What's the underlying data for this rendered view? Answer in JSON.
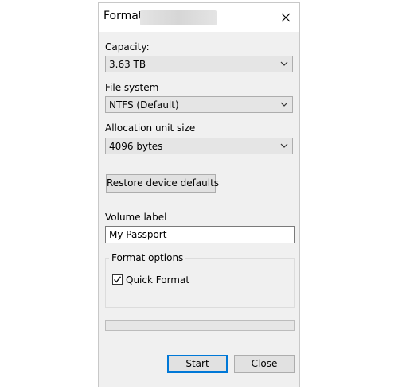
{
  "window": {
    "title": "Format",
    "close_icon": "close-icon"
  },
  "capacity": {
    "label": "Capacity:",
    "value": "3.63 TB"
  },
  "file_system": {
    "label": "File system",
    "value": "NTFS (Default)"
  },
  "allocation": {
    "label": "Allocation unit size",
    "value": "4096 bytes"
  },
  "restore_button": {
    "label": "Restore device defaults"
  },
  "volume": {
    "label": "Volume label",
    "value": "My Passport"
  },
  "format_options": {
    "legend": "Format options",
    "quick_format": {
      "label": "Quick Format",
      "checked": true
    }
  },
  "progress": {
    "fraction": 0
  },
  "buttons": {
    "start": "Start",
    "close": "Close"
  },
  "colors": {
    "accent": "#0078d7",
    "dialog_bg": "#f0f0f0"
  }
}
